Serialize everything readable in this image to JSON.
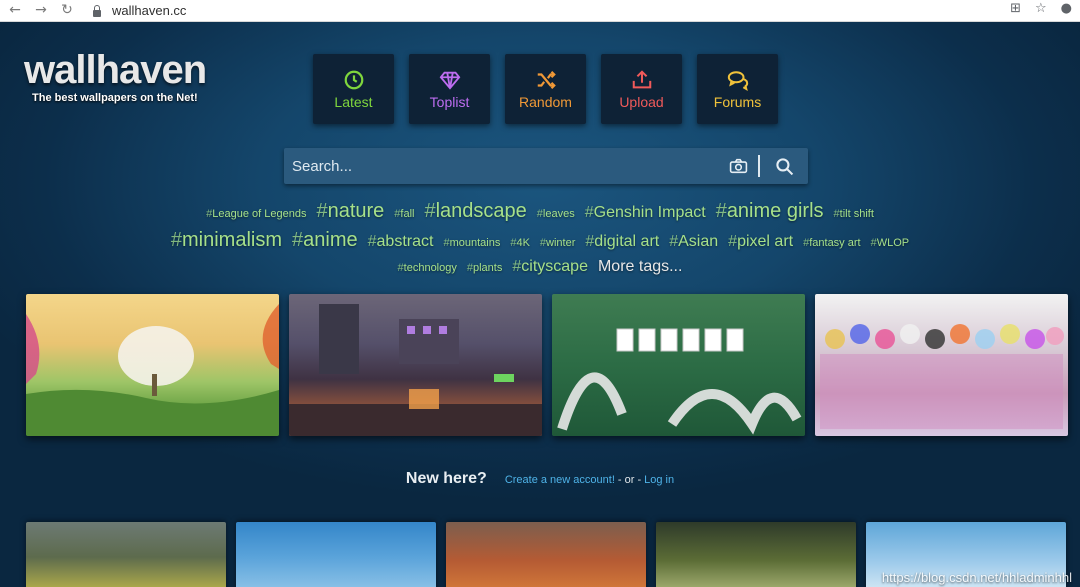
{
  "browser": {
    "url": "wallhaven.cc",
    "back_icon": "arrow-left-icon",
    "forward_icon": "arrow-right-icon",
    "reload_icon": "reload-icon"
  },
  "logo": {
    "wordmark": "wallhaven",
    "tagline": "The best wallpapers on the Net!"
  },
  "nav": [
    {
      "label": "Latest",
      "icon": "clock-icon",
      "color": "#7fd63d"
    },
    {
      "label": "Toplist",
      "icon": "diamond-icon",
      "color": "#bd6df0"
    },
    {
      "label": "Random",
      "icon": "shuffle-icon",
      "color": "#f09937"
    },
    {
      "label": "Upload",
      "icon": "upload-icon",
      "color": "#f05a5a"
    },
    {
      "label": "Forums",
      "icon": "chat-icon",
      "color": "#f0c23b"
    }
  ],
  "search": {
    "placeholder": "Search...",
    "camera_icon": "camera-icon",
    "search_icon": "magnifier-icon"
  },
  "tags": {
    "row1": [
      "League of Legends",
      "nature",
      "fall",
      "landscape",
      "leaves",
      "Genshin Impact",
      "anime girls",
      "tilt shift"
    ],
    "row2": [
      "minimalism",
      "anime",
      "abstract",
      "mountains",
      "4K",
      "winter",
      "digital art",
      "Asian",
      "pixel art",
      "fantasy art",
      "WLOP"
    ],
    "row3": [
      "technology",
      "plants",
      "cityscape"
    ],
    "more": "More tags..."
  },
  "newhere": {
    "title": "New here?",
    "create": "Create a new account!",
    "or": "- or -",
    "login": "Log in"
  },
  "watermark": "https://blog.csdn.net/hhladminhhl",
  "colors": {
    "tag_green": "#a6e08a",
    "link_blue": "#4fb3e8",
    "search_bg": "#2b5a7e"
  }
}
